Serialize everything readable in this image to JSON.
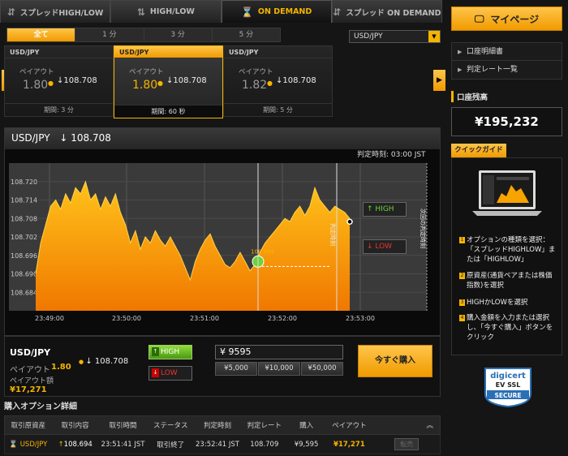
{
  "tabs": [
    {
      "label": "スプレッドHIGH/LOW",
      "icon": "spread-arrows-icon"
    },
    {
      "label": "HIGH/LOW",
      "icon": "updown-arrows-icon"
    },
    {
      "label": "ON DEMAND",
      "icon": "hourglass-icon",
      "active": true
    },
    {
      "label": "スプレッド ON DEMAND",
      "icon": "spread-arrows-icon"
    }
  ],
  "period_tabs": [
    "全て",
    "1 分",
    "3 分",
    "5 分"
  ],
  "pair_select": "USD/JPY",
  "cards": [
    {
      "pair": "USD/JPY",
      "payout_label": "ペイアウト",
      "payout": "1.80",
      "rate": "108.708",
      "period": "期間: 3 分"
    },
    {
      "pair": "USD/JPY",
      "payout_label": "ペイアウト",
      "payout": "1.80",
      "rate": "108.708",
      "period": "期間: 60 秒",
      "selected": true
    },
    {
      "pair": "USD/JPY",
      "payout_label": "ペイアウト",
      "payout": "1.82",
      "rate": "108.708",
      "period": "期間: 5 分"
    }
  ],
  "chart_header": {
    "pair": "USD/JPY",
    "rate": "108.708"
  },
  "judge_time": "判定時刻:  03:00 JST",
  "chart_buttons": {
    "high": "HIGH",
    "low": "LOW"
  },
  "chart_data": {
    "type": "area",
    "x_ticks": [
      "23:49:00",
      "23:50:00",
      "23:51:00",
      "23:52:00",
      "23:53:00"
    ],
    "y_ticks": [
      "108.720",
      "108.714",
      "108.708",
      "108.702",
      "108.696",
      "108.690",
      "108.684"
    ],
    "ylim": [
      108.678,
      108.726
    ],
    "entry_label": "108.694",
    "entry_value": 108.694,
    "vertical_labels": [
      "判定時刻",
      "次回の判定時刻"
    ],
    "color": "#f7a400"
  },
  "order": {
    "pair": "USD/JPY",
    "rate": "108.708",
    "payout_label": "ペイアウト",
    "payout": "1.80",
    "amount_label": "ペイアウト額",
    "amount": "¥17,271",
    "high": "HIGH",
    "low": "LOW",
    "input": "¥ 9595",
    "quick": [
      "¥5,000",
      "¥10,000",
      "¥50,000"
    ],
    "buy": "今すぐ購入"
  },
  "details": {
    "title": "購入オプション詳細",
    "headers": [
      "取引原資産",
      "取引内容",
      "取引時間",
      "ステータス",
      "判定時刻",
      "判定レート",
      "購入",
      "ペイアウト"
    ],
    "row": {
      "asset": "USD/JPY",
      "content": "108.694",
      "time": "23:51:41 JST",
      "status": "取引終了",
      "judge": "23:52:41 JST",
      "rate": "108.709",
      "purchase": "¥9,595",
      "payout": "¥17,271",
      "action": "転売"
    }
  },
  "sidebar": {
    "mypage": "マイページ",
    "links": [
      "口座明細書",
      "判定レート一覧"
    ],
    "balance_label": "口座残高",
    "balance": "¥195,232",
    "guide_tab": "クイックガイド",
    "guide_items": [
      "オプションの種類を選択：「スプレッドHIGHLOW」または「HIGHLOW」",
      "原資産(通貨ペアまたは株価指数)を選択",
      "HIGHかLOWを選択",
      "購入金額を入力または選択し、「今すぐ購入」ボタンをクリック"
    ],
    "ssl": {
      "line1": "digicert",
      "line2": "EV SSL",
      "line3": "SECURE"
    }
  }
}
